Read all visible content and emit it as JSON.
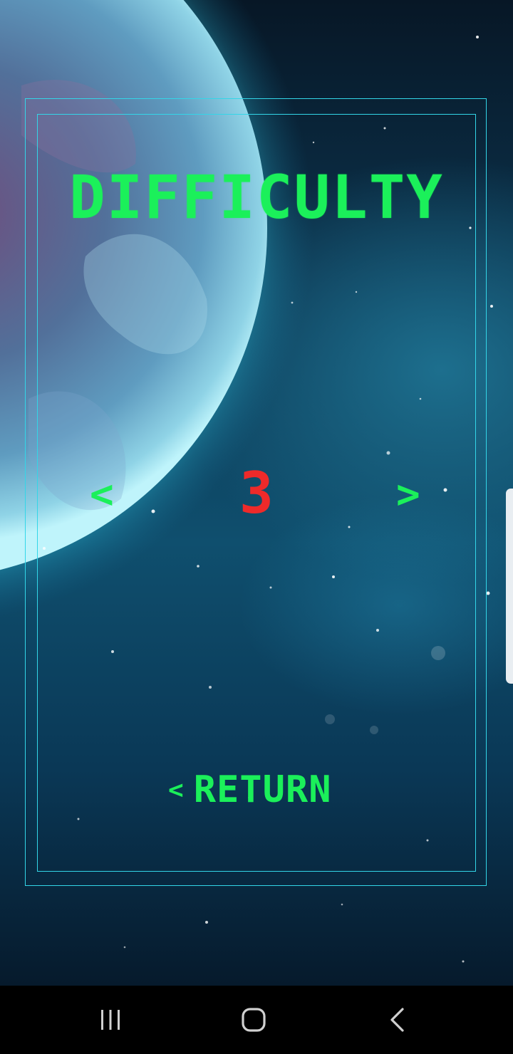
{
  "screen": {
    "title": "DIFFICULTY",
    "difficulty_value": "3",
    "decrease_label": "<",
    "increase_label": ">",
    "return_chevron": "<",
    "return_label": "RETURN"
  },
  "colors": {
    "accent_green": "#1bf05a",
    "value_red": "#ee2a2a",
    "frame_cyan": "#33d6e8",
    "navbar_bg": "#000000"
  },
  "icons": {
    "recents": "recents-icon",
    "home": "home-icon",
    "back": "back-icon"
  }
}
